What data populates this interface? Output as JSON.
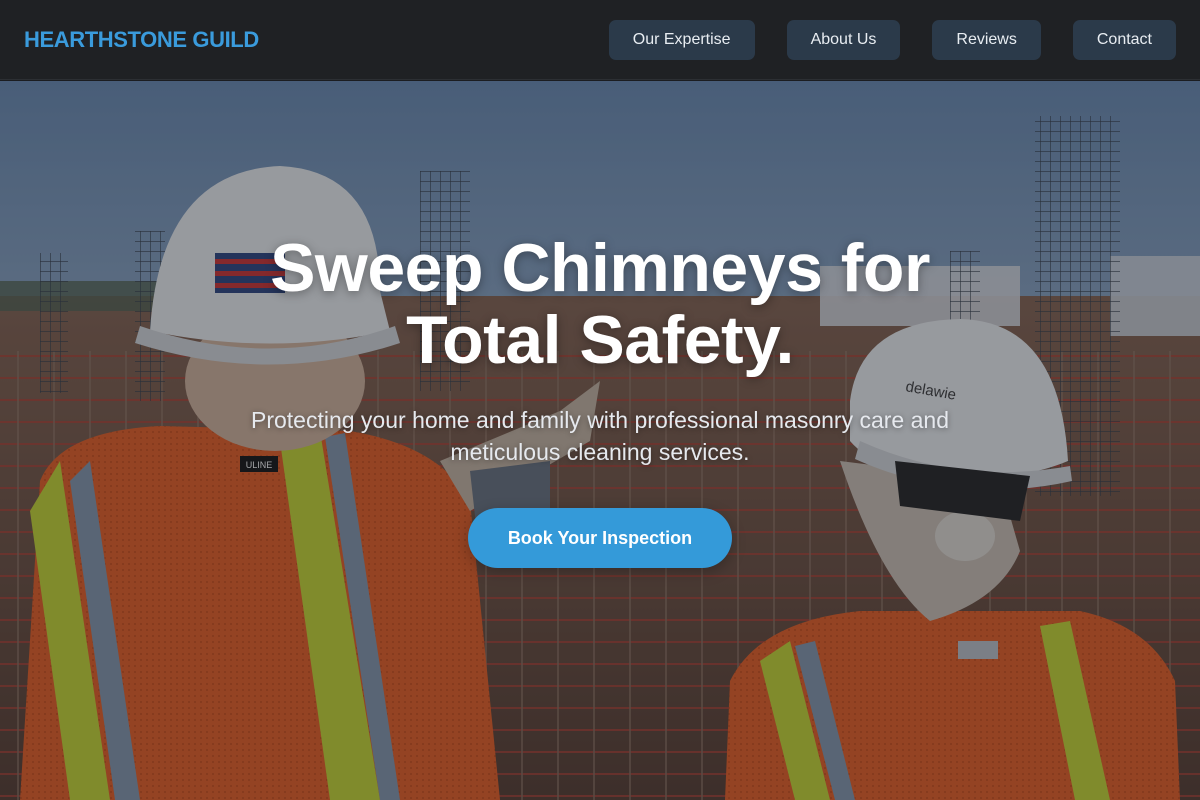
{
  "header": {
    "brand": "HEARTHSTONE GUILD",
    "nav": [
      {
        "label": "Our Expertise"
      },
      {
        "label": "About Us"
      },
      {
        "label": "Reviews"
      },
      {
        "label": "Contact"
      }
    ]
  },
  "hero": {
    "headline": "Sweep Chimneys for Total Safety.",
    "subheadline": "Protecting your home and family with professional masonry care and meticulous cleaning services.",
    "cta_label": "Book Your Inspection",
    "background_image": {
      "helmet_label_left": "",
      "vest_tag_left": "ULINE",
      "helmet_label_right": "delawie"
    }
  },
  "colors": {
    "brand": "#3a9bdc",
    "header_bg": "#1f2124",
    "nav_button_bg": "#2b3a4a",
    "cta_bg": "#349ad9"
  }
}
